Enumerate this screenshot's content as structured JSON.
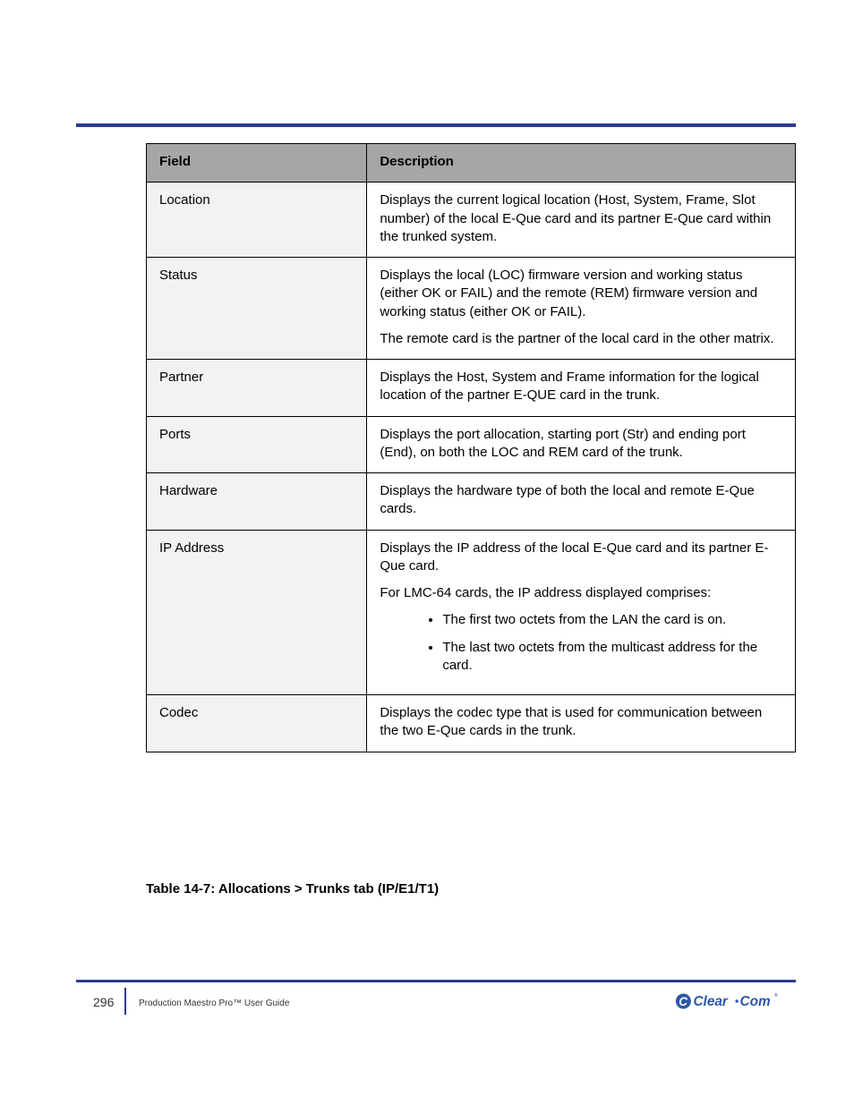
{
  "table": {
    "headers": {
      "c1": "Field",
      "c2": "Description"
    },
    "rows": [
      {
        "key": "Location",
        "desc_p1": "Displays the current logical location (Host, System, Frame, Slot number) of the local E-Que card and its partner E-Que card within the trunked system."
      },
      {
        "key": "Status",
        "desc_p1": "Displays the local (LOC) firmware version and working status (either OK or FAIL) and the remote (REM) firmware version and working status (either OK or FAIL).",
        "desc_p2": "The remote card is the partner of the local card in the other matrix."
      },
      {
        "key": "Partner",
        "desc_p1": "Displays the Host, System and Frame information for the logical location of the partner E-QUE card in the trunk."
      },
      {
        "key": "Ports",
        "desc_p1": "Displays the port allocation, starting port (Str) and ending port (End), on both the LOC and REM card of the trunk."
      },
      {
        "key": "Hardware",
        "desc_p1": "Displays the hardware type of both the local and remote E-Que cards."
      },
      {
        "key": "IP Address",
        "desc_p1": "Displays the IP address of the local E-Que card and its partner E-Que card.",
        "desc_p2": "For LMC-64 cards, the IP address displayed comprises:",
        "bullet1": "The first two octets from the LAN the card is on.",
        "bullet2": "The last two octets from the multicast address for the card."
      },
      {
        "key": "Codec",
        "desc_p1": "Displays the codec type that is used for communication between the two E-Que cards in the trunk."
      }
    ]
  },
  "caption": "Table 14-7: Allocations > Trunks tab (IP/E1/T1)",
  "footer": {
    "page_number": "296",
    "doc_line": "Production Maestro Pro™ User Guide"
  },
  "logo": {
    "brand": "Clear•Com",
    "registered": "®"
  }
}
